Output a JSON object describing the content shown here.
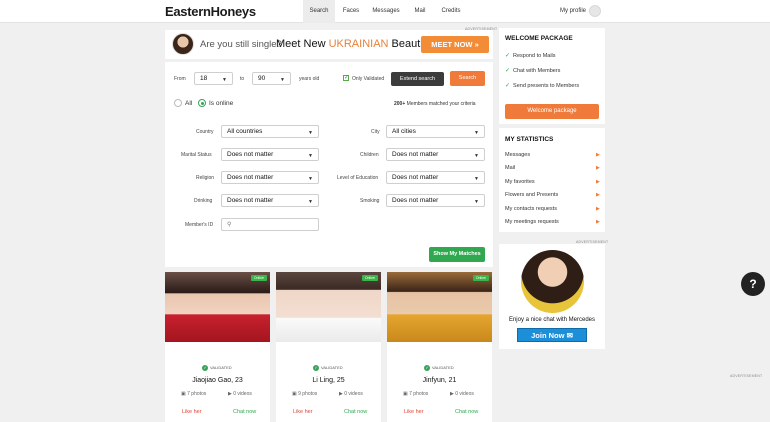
{
  "header": {
    "logo": "EasternHoneys",
    "nav": [
      "Search",
      "Faces",
      "Messages",
      "Mail",
      "Credits"
    ],
    "profile_label": "My profile"
  },
  "banner": {
    "ad_tag": "ADVERTISEMENT",
    "text1": "Are you still single?",
    "text2a": "Meet New ",
    "text2b": "UKRAINIAN",
    "text2c": " Beauties",
    "button": "MEET NOW »"
  },
  "search": {
    "from_label": "From",
    "from_value": "18",
    "to_label": "to",
    "to_value": "90",
    "years_label": "years old",
    "only_validated": "Only Validated",
    "extend_label": "Extend search",
    "search_label": "Search",
    "radio_all": "All",
    "radio_online": "Is online",
    "matched_count": "200+",
    "matched_text": "Members matched your criteria",
    "fields_left": [
      {
        "label": "Country",
        "value": "All countries"
      },
      {
        "label": "Marital Status",
        "value": "Does not matter"
      },
      {
        "label": "Religion",
        "value": "Does not matter"
      },
      {
        "label": "Drinking",
        "value": "Does not matter"
      }
    ],
    "fields_right": [
      {
        "label": "City",
        "value": "All cities"
      },
      {
        "label": "Children",
        "value": "Does not matter"
      },
      {
        "label": "Level of Education",
        "value": "Does not matter"
      },
      {
        "label": "Smoking",
        "value": "Does not matter"
      }
    ],
    "member_id_label": "Member's ID",
    "member_id_placeholder": "",
    "show_matches": "Show My Matches"
  },
  "cards": [
    {
      "online": "Online",
      "validated": "VALIDATED",
      "name": "Jiaojiao Gao, 23",
      "photos": "7 photos",
      "videos": "0 videos",
      "like": "Like her",
      "chat": "Chat now"
    },
    {
      "online": "Online",
      "validated": "VALIDATED",
      "name": "Li Ling, 25",
      "photos": "9 photos",
      "videos": "0 videos",
      "like": "Like her",
      "chat": "Chat now"
    },
    {
      "online": "Online",
      "validated": "VALIDATED",
      "name": "Jinfyun, 21",
      "photos": "7 photos",
      "videos": "0 videos",
      "like": "Like her",
      "chat": "Chat now"
    }
  ],
  "sidebar": {
    "welcome_title": "WELCOME PACKAGE",
    "welcome_items": [
      "Respond to Mails",
      "Chat with Members",
      "Send presents to Members"
    ],
    "welcome_button": "Welcome package",
    "stats_title": "MY STATISTICS",
    "stats_items": [
      "Messages",
      "Mail",
      "My favorites",
      "Flowers and Presents",
      "My contacts requests",
      "My meetings requests"
    ],
    "ad_tag": "ADVERTISEMENT",
    "ad_text": "Enjoy a nice chat with Mercedes",
    "ad_button": "Join Now",
    "ad_tag2": "ADVERTISEMENT"
  },
  "help": "?"
}
